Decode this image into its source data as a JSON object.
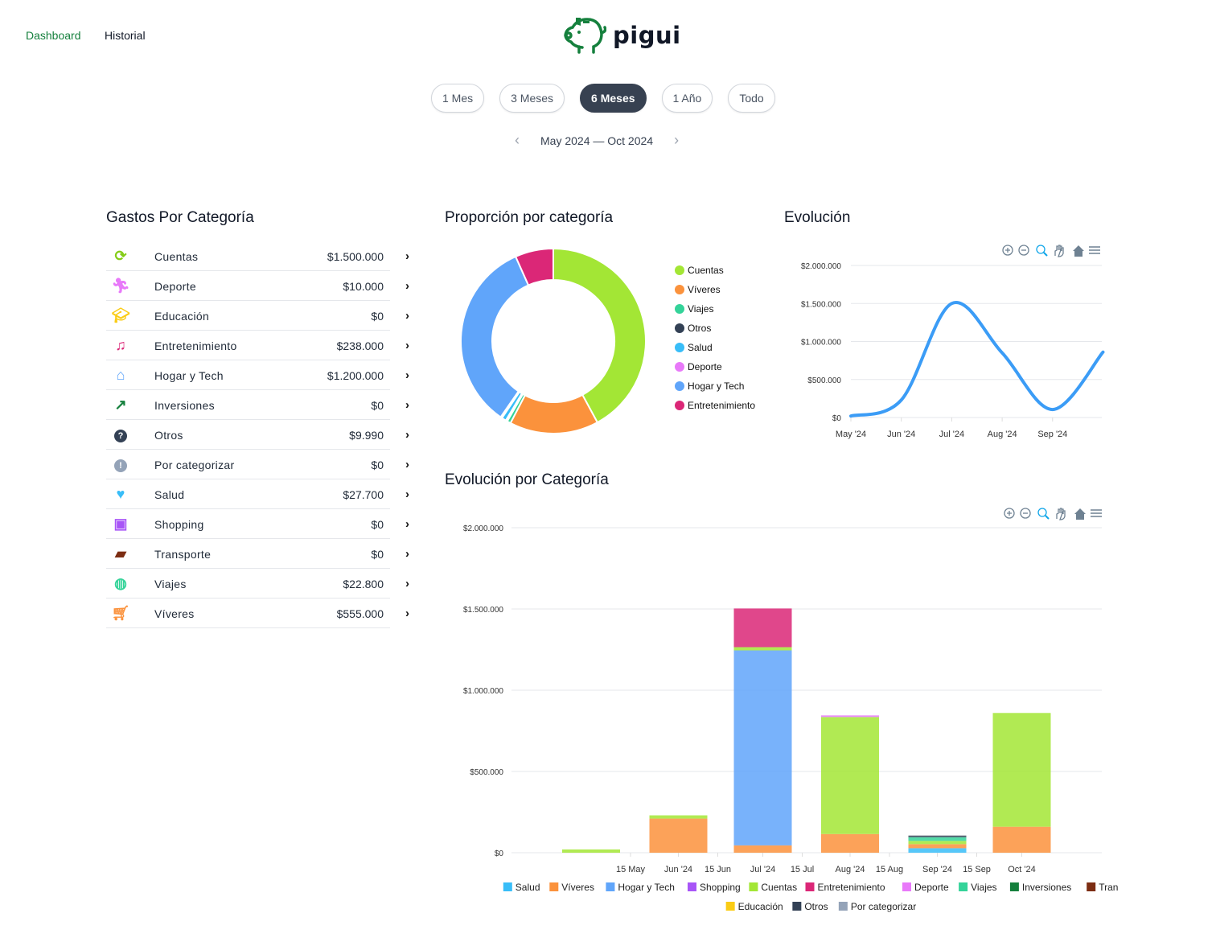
{
  "nav": {
    "items": [
      {
        "label": "Dashboard",
        "active": true
      },
      {
        "label": "Historial",
        "active": false
      }
    ],
    "active_color": "#15803d"
  },
  "logo": {
    "text": "pigui",
    "color": "#15803d"
  },
  "periods": [
    {
      "label": "1 Mes"
    },
    {
      "label": "3 Meses"
    },
    {
      "label": "6 Meses",
      "active": true
    },
    {
      "label": "1 Año"
    },
    {
      "label": "Todo"
    }
  ],
  "range": {
    "label": "May 2024 — Oct 2024",
    "prev_icon": "chevron-left-icon",
    "next_icon": "chevron-right-icon"
  },
  "gastos": {
    "title": "Gastos Por Categoría",
    "items": [
      {
        "name": "Cuentas",
        "amount": "$1.500.000",
        "icon": "refresh-icon",
        "color": "#84cc16"
      },
      {
        "name": "Deporte",
        "amount": "$10.000",
        "icon": "running-icon",
        "color": "#e879f9"
      },
      {
        "name": "Educación",
        "amount": "$0",
        "icon": "graduation-cap-icon",
        "color": "#facc15"
      },
      {
        "name": "Entretenimiento",
        "amount": "$238.000",
        "icon": "music-note-icon",
        "color": "#db2777"
      },
      {
        "name": "Hogar y Tech",
        "amount": "$1.200.000",
        "icon": "home-icon",
        "color": "#60a5fa"
      },
      {
        "name": "Inversiones",
        "amount": "$0",
        "icon": "trending-up-icon",
        "color": "#15803d"
      },
      {
        "name": "Otros",
        "amount": "$9.990",
        "icon": "question-circle-icon",
        "color": "#334155"
      },
      {
        "name": "Por categorizar",
        "amount": "$0",
        "icon": "exclamation-circle-icon",
        "color": "#94a3b8"
      },
      {
        "name": "Salud",
        "amount": "$27.700",
        "icon": "heart-icon",
        "color": "#38bdf8"
      },
      {
        "name": "Shopping",
        "amount": "$0",
        "icon": "shopping-bag-icon",
        "color": "#a855f7"
      },
      {
        "name": "Transporte",
        "amount": "$0",
        "icon": "truck-icon",
        "color": "#7c2d12"
      },
      {
        "name": "Viajes",
        "amount": "$22.800",
        "icon": "globe-icon",
        "color": "#34d399"
      },
      {
        "name": "Víveres",
        "amount": "$555.000",
        "icon": "cart-icon",
        "color": "#fb923c"
      }
    ]
  },
  "proporcion": {
    "title": "Proporción por categoría"
  },
  "evolucion": {
    "title": "Evolución"
  },
  "evolucion_cat": {
    "title": "Evolución por Categoría"
  },
  "chart_data": [
    {
      "type": "pie",
      "variant": "donut",
      "legend": "right",
      "slices": [
        {
          "name": "Cuentas",
          "value": 1500000,
          "color": "#a3e635"
        },
        {
          "name": "Víveres",
          "value": 555000,
          "color": "#fb923c"
        },
        {
          "name": "Viajes",
          "value": 22800,
          "color": "#34d399"
        },
        {
          "name": "Otros",
          "value": 9990,
          "color": "#334155"
        },
        {
          "name": "Salud",
          "value": 27700,
          "color": "#38bdf8"
        },
        {
          "name": "Deporte",
          "value": 10000,
          "color": "#e879f9"
        },
        {
          "name": "Hogar y Tech",
          "value": 1200000,
          "color": "#60a5fa"
        },
        {
          "name": "Entretenimiento",
          "value": 238000,
          "color": "#db2777"
        }
      ]
    },
    {
      "type": "line",
      "smooth": true,
      "color": "#3b9cf6",
      "grid": true,
      "categories": [
        "May '24",
        "Jun '24",
        "Jul '24",
        "Aug '24",
        "Sep '24",
        "Oct '24"
      ],
      "xticks": [
        "May '24",
        "Jun '24",
        "Jul '24",
        "Aug '24",
        "Sep '24"
      ],
      "values": [
        20000,
        230000,
        1500000,
        850000,
        105000,
        860000
      ],
      "ylim": [
        0,
        2000000
      ],
      "yticks": [
        "$0",
        "$500.000",
        "$1.000.000",
        "$1.500.000",
        "$2.000.000"
      ]
    },
    {
      "type": "bar",
      "stacked": true,
      "grid": true,
      "legend": "bottom",
      "x": [
        "2024-05-01",
        "2024-06-01",
        "2024-07-01",
        "2024-08-01",
        "2024-09-01",
        "2024-10-01"
      ],
      "xticks": [
        {
          "date": "2024-05-15",
          "label": "15 May"
        },
        {
          "date": "2024-06-01",
          "label": "Jun '24"
        },
        {
          "date": "2024-06-15",
          "label": "15 Jun"
        },
        {
          "date": "2024-07-01",
          "label": "Jul '24"
        },
        {
          "date": "2024-07-15",
          "label": "15 Jul"
        },
        {
          "date": "2024-08-01",
          "label": "Aug '24"
        },
        {
          "date": "2024-08-15",
          "label": "15 Aug"
        },
        {
          "date": "2024-09-01",
          "label": "Sep '24"
        },
        {
          "date": "2024-09-15",
          "label": "15 Sep"
        },
        {
          "date": "2024-10-01",
          "label": "Oct '24"
        }
      ],
      "ylim": [
        0,
        2000000
      ],
      "yticks": [
        "$0",
        "$500.000",
        "$1.000.000",
        "$1.500.000",
        "$2.000.000"
      ],
      "series": [
        {
          "name": "Salud",
          "color": "#38bdf8",
          "values": [
            0,
            0,
            0,
            0,
            27700,
            0
          ]
        },
        {
          "name": "Víveres",
          "color": "#fb923c",
          "values": [
            0,
            210000,
            45000,
            115000,
            25000,
            160000
          ]
        },
        {
          "name": "Hogar y Tech",
          "color": "#60a5fa",
          "values": [
            0,
            0,
            1200000,
            0,
            0,
            0
          ]
        },
        {
          "name": "Shopping",
          "color": "#a855f7",
          "values": [
            0,
            0,
            0,
            0,
            0,
            0
          ]
        },
        {
          "name": "Cuentas",
          "color": "#a3e635",
          "values": [
            20000,
            20000,
            20000,
            720000,
            20000,
            700000
          ]
        },
        {
          "name": "Entretenimiento",
          "color": "#db2777",
          "values": [
            0,
            0,
            238000,
            0,
            0,
            0
          ]
        },
        {
          "name": "Deporte",
          "color": "#e879f9",
          "values": [
            0,
            0,
            0,
            10000,
            0,
            0
          ]
        },
        {
          "name": "Viajes",
          "color": "#34d399",
          "values": [
            0,
            0,
            0,
            0,
            22800,
            0
          ]
        },
        {
          "name": "Inversiones",
          "color": "#15803d",
          "values": [
            0,
            0,
            0,
            0,
            0,
            0
          ]
        },
        {
          "name": "Transporte",
          "color": "#7c2d12",
          "values": [
            0,
            0,
            0,
            0,
            0,
            0
          ]
        },
        {
          "name": "Educación",
          "color": "#facc15",
          "values": [
            0,
            0,
            0,
            0,
            0,
            0
          ]
        },
        {
          "name": "Otros",
          "color": "#334155",
          "values": [
            0,
            0,
            0,
            0,
            9990,
            0
          ]
        },
        {
          "name": "Por categorizar",
          "color": "#94a3b8",
          "values": [
            0,
            0,
            0,
            0,
            0,
            0
          ]
        }
      ]
    }
  ],
  "toolbar": {
    "icons": [
      "zoom-in-icon",
      "zoom-out-icon",
      "selection-zoom-icon",
      "pan-icon",
      "reset-home-icon",
      "menu-icon"
    ]
  }
}
